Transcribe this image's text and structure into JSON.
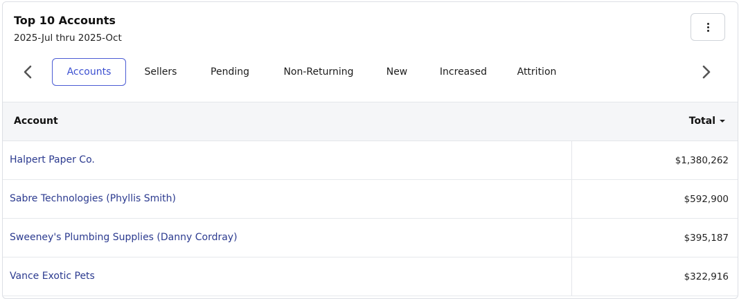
{
  "header": {
    "title": "Top 10 Accounts",
    "date_range": "2025-Jul thru 2025-Oct"
  },
  "menu_icon": "kebab-menu-icon",
  "tabs": [
    {
      "label": "Accounts",
      "active": true
    },
    {
      "label": "Sellers",
      "active": false
    },
    {
      "label": "Pending",
      "active": false
    },
    {
      "label": "Non-Returning",
      "active": false
    },
    {
      "label": "New",
      "active": false
    },
    {
      "label": "Increased",
      "active": false
    },
    {
      "label": "Attrition",
      "active": false
    }
  ],
  "table": {
    "columns": {
      "account": "Account",
      "total": "Total"
    },
    "sort": {
      "column": "Total",
      "direction": "descending"
    },
    "rows": [
      {
        "account": "Halpert Paper Co.",
        "total": "$1,380,262"
      },
      {
        "account": "Sabre Technologies (Phyllis Smith)",
        "total": "$592,900"
      },
      {
        "account": "Sweeney's Plumbing Supplies (Danny Cordray)",
        "total": "$395,187"
      },
      {
        "account": "Vance Exotic Pets",
        "total": "$322,916"
      }
    ]
  },
  "colors": {
    "accent": "#4a5bd4",
    "link": "#2b3a8f",
    "header_bg": "#f5f6f8",
    "border": "#dcdfe4"
  }
}
